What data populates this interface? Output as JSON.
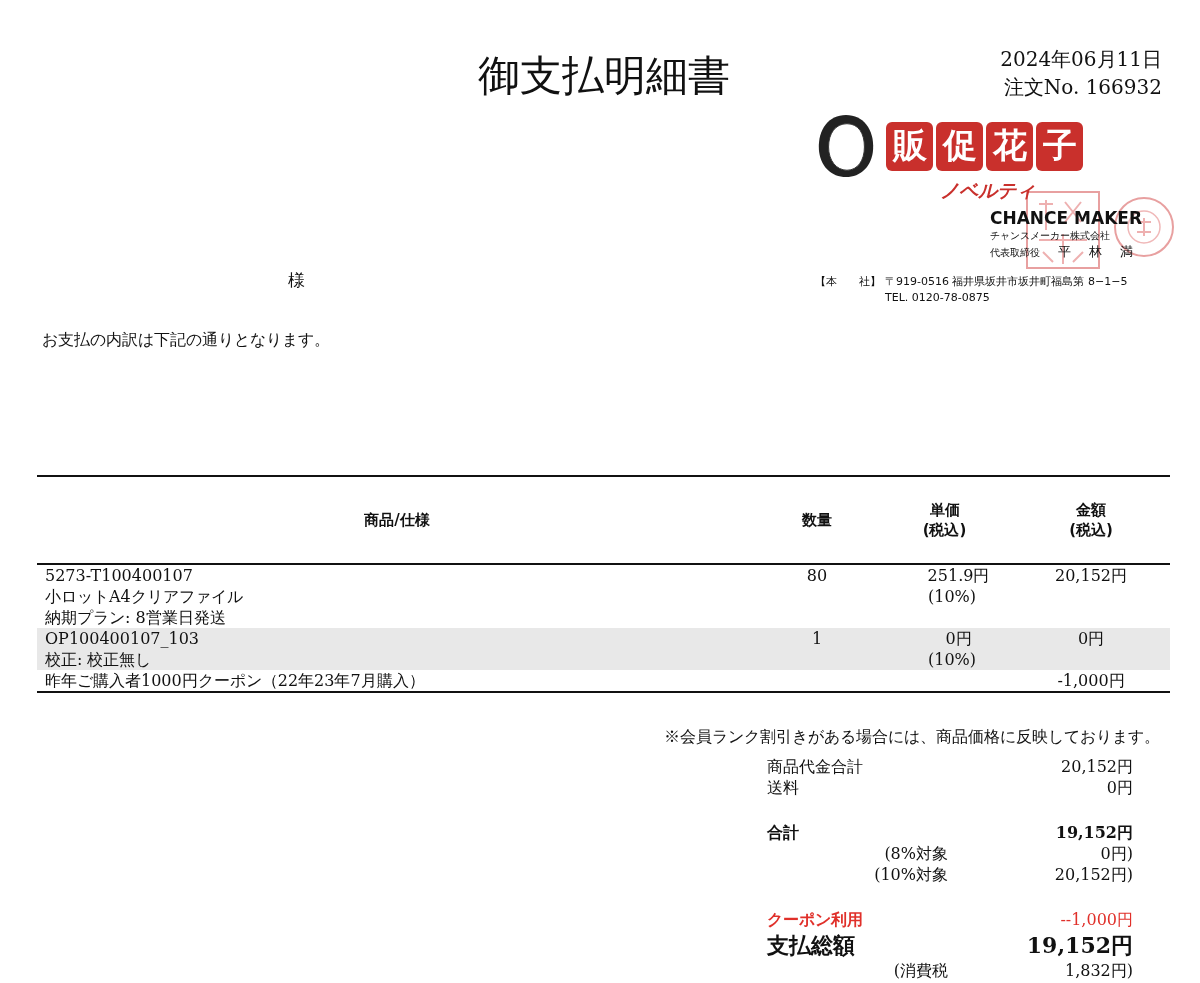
{
  "title": "御支払明細書",
  "date": "2024年06月11日",
  "order_no": "注文No. 166932",
  "company": {
    "brand_chars": [
      "販",
      "促",
      "花",
      "子"
    ],
    "brand_sub": "ノベルティ",
    "name_en": "CHANCE MAKER",
    "name_ja": "チャンスメーカー株式会社",
    "rep_title": "代表取締役",
    "rep_name": [
      "平",
      "林",
      "満"
    ],
    "office_label": "【本　　社】",
    "address": "〒919-0516 福井県坂井市坂井町福島第 8−1−5",
    "tel": "TEL. 0120-78-0875"
  },
  "customer_suffix": "様",
  "intro": "お支払の内訳は下記の通りとなります。",
  "table": {
    "columns": [
      "商品/仕様",
      "数量",
      "単価\n(税込)",
      "金額\n(税込)"
    ],
    "rows": [
      {
        "shaded": false,
        "lines": [
          "5273-T100400107",
          "小ロットA4クリアファイル",
          "納期プラン: 8営業日発送"
        ],
        "qty": "80",
        "price": "251.9円",
        "tax": "(10%)",
        "amount": "20,152円"
      },
      {
        "shaded": true,
        "lines": [
          "OP100400107_103",
          "校正: 校正無し"
        ],
        "qty": "1",
        "price": "0円",
        "tax": "(10%)",
        "amount": "0円"
      },
      {
        "shaded": false,
        "lines": [
          "昨年ご購入者1000円クーポン（22年23年7月購入）"
        ],
        "amount": "-1,000円"
      }
    ]
  },
  "note": "※会員ランク割引きがある場合には、商品価格に反映しております。",
  "summary": [
    [
      {
        "kind": "plain",
        "label": "商品代金合計",
        "value": "20,152円"
      },
      {
        "kind": "plain",
        "label": "送料",
        "value": "0円"
      }
    ],
    [
      {
        "kind": "bold",
        "label": "合計",
        "value": "19,152円"
      },
      {
        "kind": "sub",
        "label": "(8%対象",
        "value": "0円)"
      },
      {
        "kind": "sub",
        "label": "(10%対象",
        "value": "20,152円)"
      }
    ],
    [
      {
        "kind": "coupon",
        "label": "クーポン利用",
        "value": "--1,000円"
      },
      {
        "kind": "grand",
        "label": "支払総額",
        "value": "19,152円"
      },
      {
        "kind": "sub",
        "label": "(消費税",
        "value": "1,832円)"
      }
    ]
  ]
}
